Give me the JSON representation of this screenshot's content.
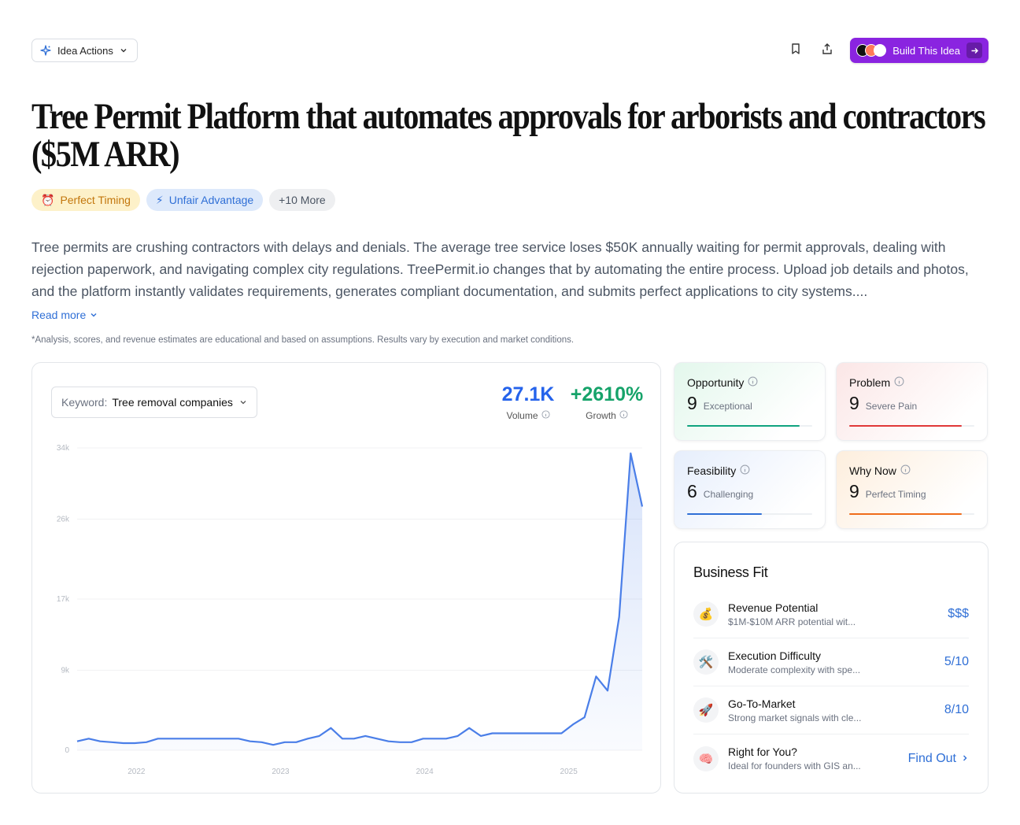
{
  "topbar": {
    "idea_actions_label": "Idea Actions",
    "build_label": "Build This Idea"
  },
  "title": "Tree Permit Platform that automates approvals for arborists and contractors ($5M ARR)",
  "tags": [
    {
      "icon": "⏰",
      "label": "Perfect Timing"
    },
    {
      "icon": "⚡",
      "label": "Unfair Advantage"
    },
    {
      "label": "+10 More"
    }
  ],
  "description": "Tree permits are crushing contractors with delays and denials. The average tree service loses $50K annually waiting for permit approvals, dealing with rejection paperwork, and navigating complex city regulations. TreePermit.io changes that by automating the entire process. Upload job details and photos, and the platform instantly validates requirements, generates compliant documentation, and submits perfect applications to city systems....",
  "read_more": "Read more",
  "disclaimer": "*Analysis, scores, and revenue estimates are educational and based on assumptions. Results vary by execution and market conditions.",
  "keyword": {
    "label": "Keyword:",
    "value": "Tree removal companies"
  },
  "stats": {
    "volume": {
      "value": "27.1K",
      "label": "Volume",
      "color": "#2563eb"
    },
    "growth": {
      "value": "+2610%",
      "label": "Growth",
      "color": "#16a36a"
    }
  },
  "chart_data": {
    "type": "area",
    "y_ticks": [
      "34k",
      "26k",
      "17k",
      "9k",
      "0"
    ],
    "y_tick_values": [
      34000,
      26000,
      17000,
      9000,
      0
    ],
    "x_ticks": [
      "2022",
      "2023",
      "2024",
      "2025"
    ],
    "ylim": [
      0,
      34000
    ],
    "grid": true,
    "color": "#4a7ee8",
    "values": [
      1000,
      1300,
      1000,
      900,
      800,
      800,
      900,
      1300,
      1300,
      1300,
      1300,
      1300,
      1300,
      1300,
      1300,
      1000,
      900,
      600,
      900,
      900,
      1300,
      1600,
      2500,
      1300,
      1300,
      1600,
      1300,
      1000,
      900,
      900,
      1300,
      1300,
      1300,
      1600,
      2500,
      1600,
      1900,
      1900,
      1900,
      1900,
      1900,
      1900,
      1900,
      2900,
      3700,
      8300,
      6700,
      15000,
      33400,
      27400
    ]
  },
  "scores": [
    {
      "name": "Opportunity",
      "value": "9",
      "sub": "Exceptional",
      "fill": 0.9,
      "color": "#10a37f",
      "bg": "linear-gradient(135deg,#e3f7ec 0%,#ffffff 80%)"
    },
    {
      "name": "Problem",
      "value": "9",
      "sub": "Severe Pain",
      "fill": 0.9,
      "color": "#e03838",
      "bg": "linear-gradient(135deg,#fbe6e6 0%,#ffffff 80%)"
    },
    {
      "name": "Feasibility",
      "value": "6",
      "sub": "Challenging",
      "fill": 0.6,
      "color": "#2f6fd6",
      "bg": "linear-gradient(135deg,#e6eefc 0%,#ffffff 80%)"
    },
    {
      "name": "Why Now",
      "value": "9",
      "sub": "Perfect Timing",
      "fill": 0.9,
      "color": "#ef6c1a",
      "bg": "linear-gradient(135deg,#fdeedd 0%,#ffffff 80%)"
    }
  ],
  "business_fit": {
    "title": "Business Fit",
    "rows": [
      {
        "icon": "💰",
        "name": "Revenue Potential",
        "desc": "$1M-$10M ARR potential wit...",
        "value": "$$$"
      },
      {
        "icon": "🛠️",
        "name": "Execution Difficulty",
        "desc": "Moderate complexity with spe...",
        "value": "5/10"
      },
      {
        "icon": "🚀",
        "name": "Go-To-Market",
        "desc": "Strong market signals with cle...",
        "value": "8/10"
      },
      {
        "icon": "🧠",
        "name": "Right for You?",
        "desc": "Ideal for founders with GIS an...",
        "value": "Find Out"
      }
    ]
  }
}
